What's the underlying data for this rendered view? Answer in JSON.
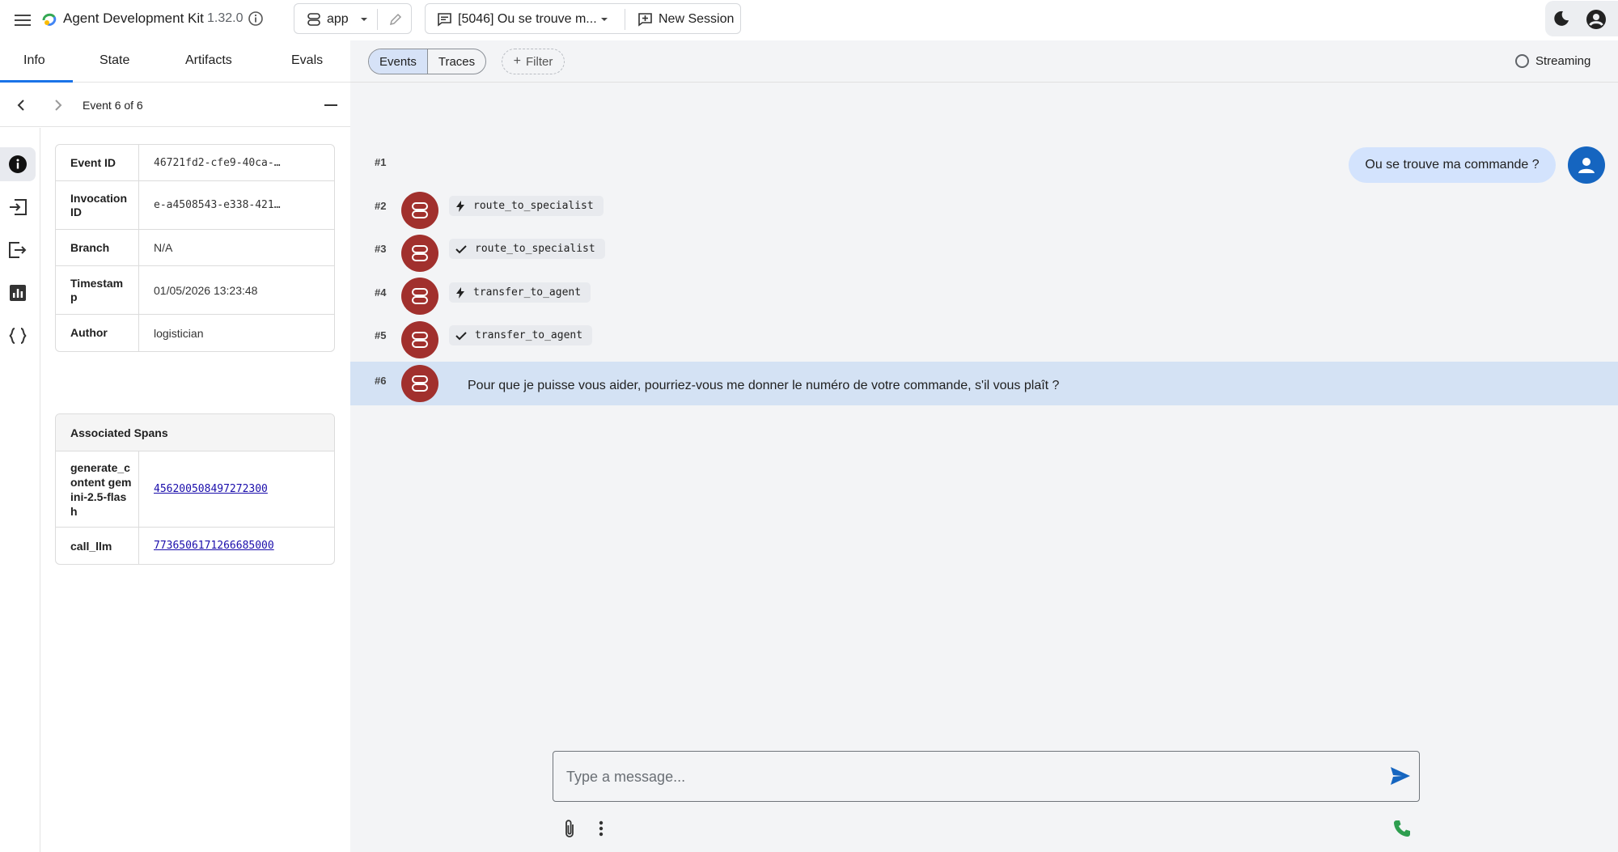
{
  "header": {
    "title": "Agent Development Kit",
    "version": "1.32.0",
    "app_name": "app",
    "session_name": "[5046] Ou se trouve m...",
    "new_session_label": "New Session"
  },
  "left_tabs": [
    "Info",
    "State",
    "Artifacts",
    "Evals"
  ],
  "event_nav": {
    "label": "Event 6 of 6"
  },
  "details": [
    {
      "key": "Event ID",
      "value": "46721fd2-cfe9-40ca-…"
    },
    {
      "key": "Invocation ID",
      "value": "e-a4508543-e338-421…"
    },
    {
      "key": "Branch",
      "value": "N/A"
    },
    {
      "key": "Timestamp",
      "value": "01/05/2026 13:23:48"
    },
    {
      "key": "Author",
      "value": "logistician"
    }
  ],
  "spans": {
    "title": "Associated Spans",
    "rows": [
      {
        "key": "generate_content gemini-2.5-flash",
        "value": "456200508497272300"
      },
      {
        "key": "call_llm",
        "value": "7736506171266685000"
      }
    ]
  },
  "toolbar": {
    "events_label": "Events",
    "traces_label": "Traces",
    "filter_label": "Filter",
    "streaming_label": "Streaming"
  },
  "events": {
    "e1": {
      "num": "#1",
      "text": "Ou se trouve ma commande ?"
    },
    "e2": {
      "num": "#2",
      "text": "route_to_specialist",
      "icon": "bolt-icon"
    },
    "e3": {
      "num": "#3",
      "text": "route_to_specialist",
      "icon": "check-icon"
    },
    "e4": {
      "num": "#4",
      "text": "transfer_to_agent",
      "icon": "bolt-icon"
    },
    "e5": {
      "num": "#5",
      "text": "transfer_to_agent",
      "icon": "check-icon"
    },
    "e6": {
      "num": "#6",
      "text": "Pour que je puisse vous aider, pourriez-vous me donner le numéro de votre commande, s'il vous plaît ?"
    }
  },
  "composer": {
    "placeholder": "Type a message..."
  },
  "colors": {
    "agent_avatar": "#a1302d",
    "user_avatar": "#1565c0",
    "user_bubble": "#d3e3fd",
    "selected_row": "#d4e2f4",
    "accent": "#1a73e8",
    "call_icon": "#2e9e4f"
  }
}
